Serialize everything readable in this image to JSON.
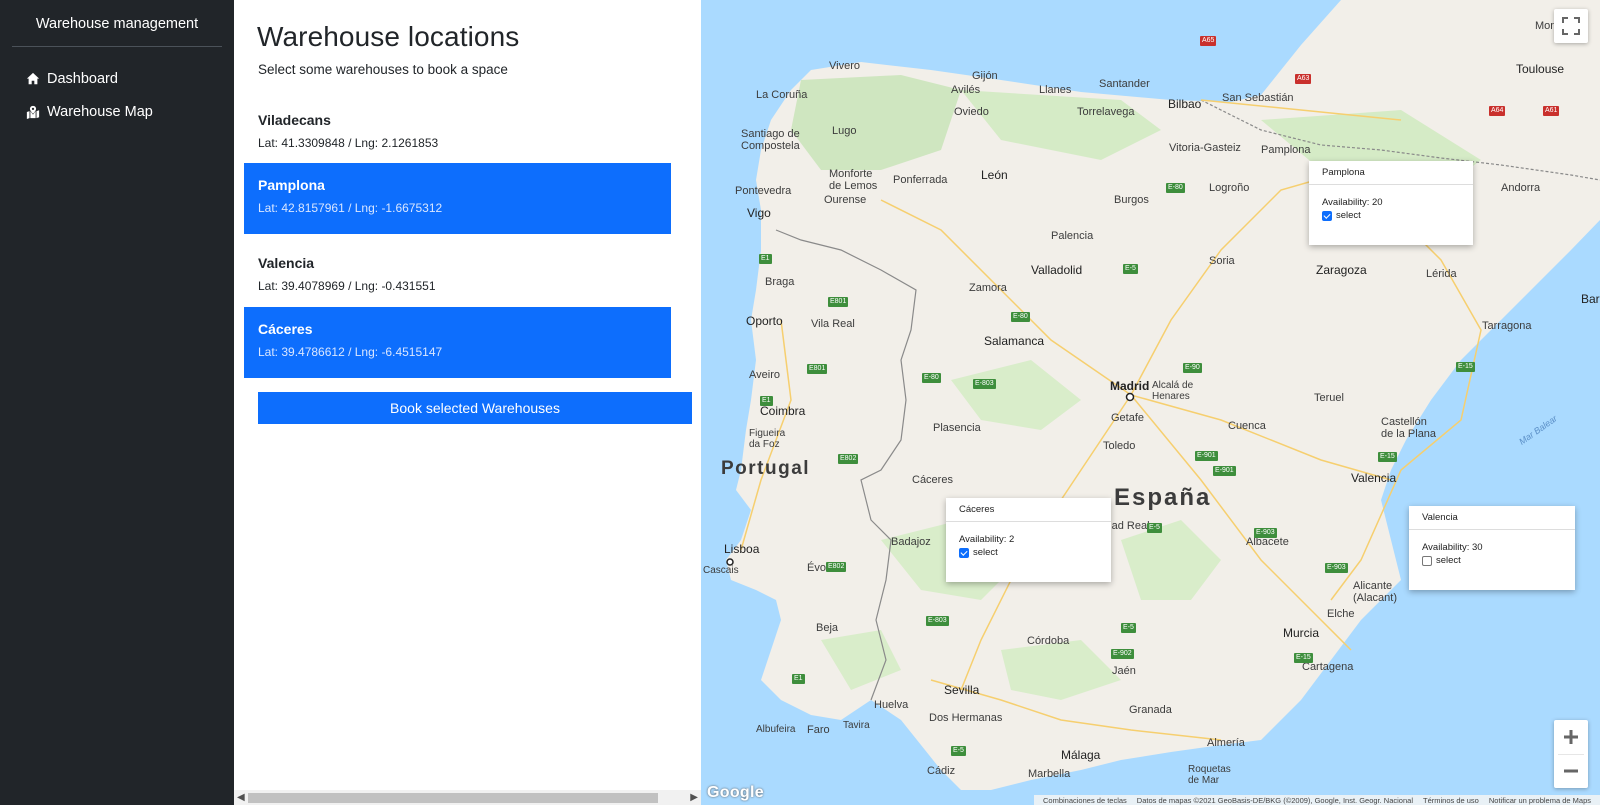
{
  "sidebar": {
    "brand": "Warehouse management",
    "items": [
      {
        "label": "Dashboard",
        "icon": "house-icon"
      },
      {
        "label": "Warehouse Map",
        "icon": "map-icon"
      }
    ]
  },
  "panel": {
    "title": "Warehouse locations",
    "subtitle": "Select some warehouses to book a space",
    "locations": [
      {
        "name": "Viladecans",
        "coords": "Lat: 41.3309848 / Lng: 2.1261853",
        "selected": false
      },
      {
        "name": "Pamplona",
        "coords": "Lat: 42.8157961 / Lng: -1.6675312",
        "selected": true
      },
      {
        "name": "Valencia",
        "coords": "Lat: 39.4078969 / Lng: -0.431551",
        "selected": false
      },
      {
        "name": "Cáceres",
        "coords": "Lat: 39.4786612 / Lng: -6.4515147",
        "selected": true
      }
    ],
    "book_button": "Book selected Warehouses"
  },
  "map": {
    "countries": {
      "portugal": "Portugal",
      "espana": "España"
    },
    "cities": {
      "vivero": "Vivero",
      "gijon": "Gijón",
      "llanes": "Llanes",
      "santander": "Santander",
      "bilbao": "Bilbao",
      "san_sebastian": "San Sebastián",
      "montauban": "Montau",
      "toulouse": "Toulouse",
      "la_coruna": "La Coruña",
      "aviles": "Avilés",
      "oviedo": "Oviedo",
      "torrelavega": "Torrelavega",
      "santiago": "Santiago de\nCompostela",
      "lugo": "Lugo",
      "vitoria": "Vitoria-Gasteiz",
      "pamplona": "Pamplona",
      "ponferrada": "Ponferrada",
      "monforte": "Monforte\nde Lemos",
      "leon": "León",
      "logrono": "Logroño",
      "pontevedra": "Pontevedra",
      "ourense": "Ourense",
      "burgos": "Burgos",
      "andorra": "Andorra",
      "vigo": "Vigo",
      "palencia": "Palencia",
      "valladolid": "Valladolid",
      "soria": "Soria",
      "zaragoza": "Zaragoza",
      "lerida": "Lérida",
      "bar": "Bar",
      "braga": "Braga",
      "zamora": "Zamora",
      "oporto": "Oporto",
      "vila_real": "Vila Real",
      "tarragona": "Tarragona",
      "salamanca": "Salamanca",
      "aveiro": "Aveiro",
      "madrid": "Madrid",
      "alcala": "Alcalá de\nHenares",
      "getafe": "Getafe",
      "teruel": "Teruel",
      "coimbra": "Coimbra",
      "figueira": "Figueira\nda Foz",
      "plasencia": "Plasencia",
      "toledo": "Toledo",
      "cuenca": "Cuenca",
      "castellon": "Castellón\nde la Plana",
      "caceres": "Cáceres",
      "valencia": "Valencia",
      "ciudad_real": "Ciudad Real",
      "lisboa": "Lisboa",
      "cascais": "Cascais",
      "badajoz": "Badajoz",
      "evora": "Évora",
      "albacete": "Albacete",
      "alicante": "Alicante\n(Alacant)",
      "elche": "Elche",
      "beja": "Beja",
      "cordoba": "Córdoba",
      "murcia": "Murcia",
      "jaen": "Jaén",
      "cartagena": "Cartagena",
      "sevilla": "Sevilla",
      "huelva": "Huelva",
      "granada": "Granada",
      "almeria": "Almería",
      "dos_hermanas": "Dos Hermanas",
      "albufeira": "Albufeira",
      "faro": "Faro",
      "tavira": "Tavira",
      "malaga": "Málaga",
      "cadiz": "Cádiz",
      "marbella": "Marbella",
      "roquetas": "Roquetas\nde Mar",
      "mar_balear": "Mar Balear"
    },
    "infowindows": [
      {
        "title": "Pamplona",
        "availability": "Availability: 20",
        "select_label": "select",
        "checked": true
      },
      {
        "title": "Cáceres",
        "availability": "Availability: 2",
        "select_label": "select",
        "checked": true
      },
      {
        "title": "Valencia",
        "availability": "Availability: 30",
        "select_label": "select",
        "checked": false
      }
    ],
    "google": "Google",
    "attribution": [
      "Combinaciones de teclas",
      "Datos de mapas ©2021 GeoBasis-DE/BKG (©2009), Google, Inst. Geogr. Nacional",
      "Términos de uso",
      "Notificar un problema de Maps"
    ],
    "roads": [
      "A65",
      "A63",
      "A64",
      "A61",
      "E-80",
      "E1",
      "E801",
      "E-5",
      "E-80",
      "E-90",
      "E-15",
      "E-80",
      "E-803",
      "E801",
      "E-901",
      "E-901",
      "E1",
      "E802",
      "E-5",
      "E-903",
      "E-903",
      "E802",
      "E-803",
      "E-5",
      "E-902",
      "E-15",
      "E1",
      "E-5",
      "E-15"
    ],
    "colors": {
      "water": "#aadaff",
      "land": "#f2efe9",
      "green": "#cfe6c0",
      "accent": "#0d6efd",
      "sidebar": "#212529"
    }
  }
}
